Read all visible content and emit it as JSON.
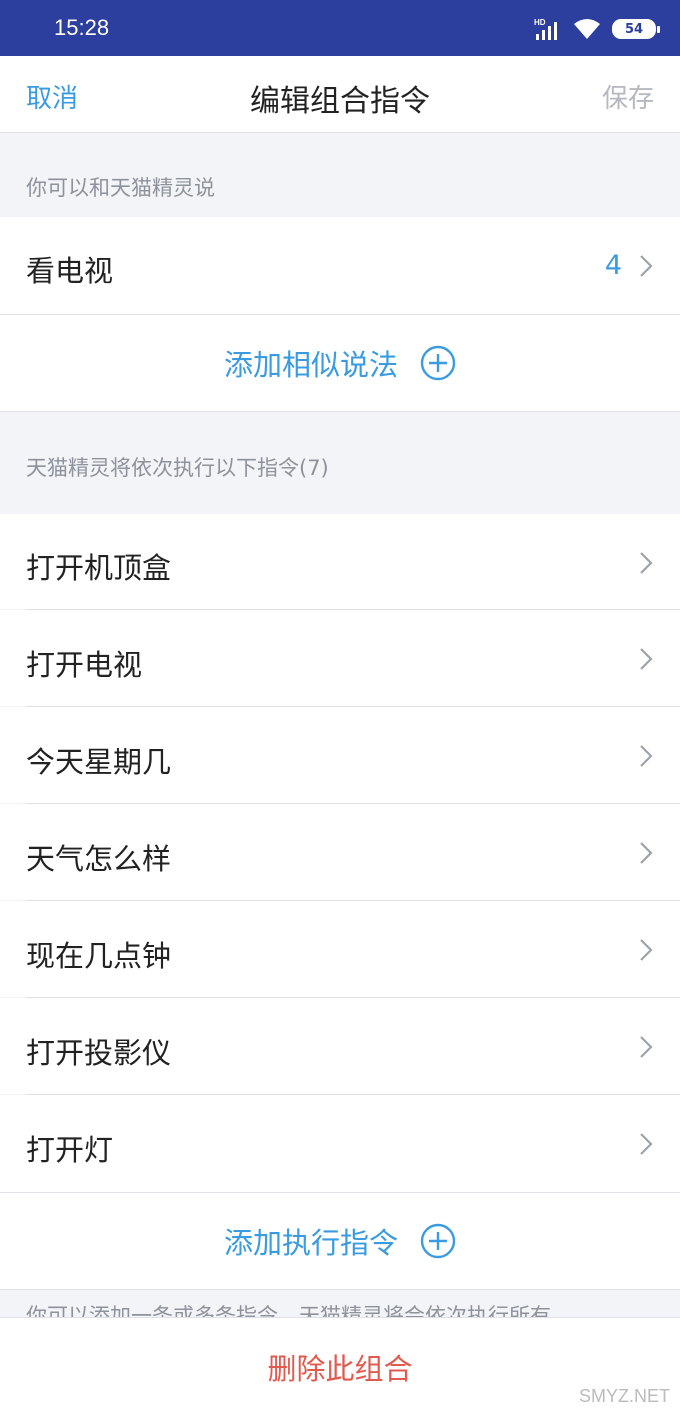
{
  "status_bar": {
    "time": "15:28",
    "network": "HD",
    "battery": "54"
  },
  "nav": {
    "cancel": "取消",
    "title": "编辑组合指令",
    "save": "保存"
  },
  "say_section": {
    "caption": "你可以和天猫精灵说",
    "phrase": "看电视",
    "phrase_count": "4",
    "add_label": "添加相似说法"
  },
  "exec_section": {
    "caption": "天猫精灵将依次执行以下指令(7)",
    "commands": [
      "打开机顶盒",
      "打开电视",
      "今天星期几",
      "天气怎么样",
      "现在几点钟",
      "打开投影仪",
      "打开灯"
    ],
    "add_label": "添加执行指令"
  },
  "footer": {
    "hint": "你可以添加一条或多条指令，天猫精灵将会依次执行所有",
    "delete": "删除此组合"
  },
  "watermark": "SMYZ.NET",
  "colors": {
    "accent": "#3a9be0",
    "danger": "#e05a4e",
    "statusbar": "#2c3e9e"
  }
}
